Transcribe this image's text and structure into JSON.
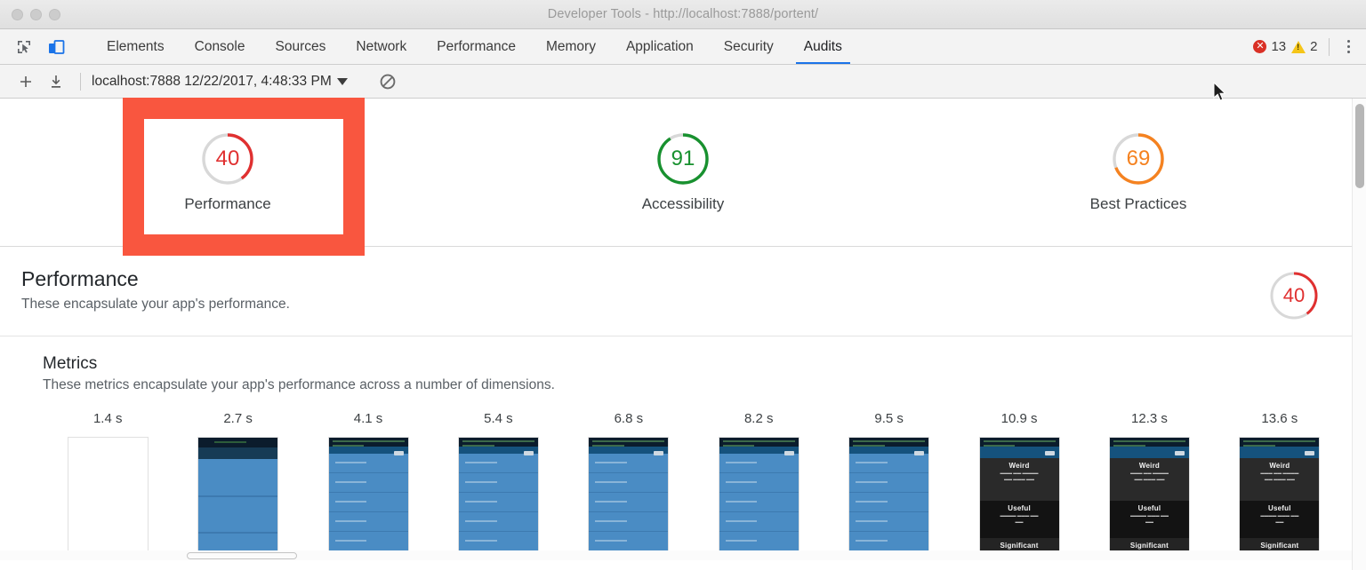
{
  "window": {
    "title": "Developer Tools - http://localhost:7888/portent/",
    "traffic_lights": [
      "close",
      "minimize",
      "zoom"
    ]
  },
  "devtools_tabbar": {
    "icons": [
      {
        "name": "inspect-element-icon",
        "glyph": "cursor-in-box"
      },
      {
        "name": "device-toolbar-icon",
        "glyph": "phone-tablet"
      }
    ],
    "tabs": [
      {
        "label": "Elements",
        "active": false
      },
      {
        "label": "Console",
        "active": false
      },
      {
        "label": "Sources",
        "active": false
      },
      {
        "label": "Network",
        "active": false
      },
      {
        "label": "Performance",
        "active": false
      },
      {
        "label": "Memory",
        "active": false
      },
      {
        "label": "Application",
        "active": false
      },
      {
        "label": "Security",
        "active": false
      },
      {
        "label": "Audits",
        "active": true
      }
    ],
    "error_count": "13",
    "warning_count": "2",
    "more_menu": "kebab-menu"
  },
  "audits_toolbar": {
    "add_label": "+",
    "import_label": "import",
    "report_selector": "localhost:7888 12/22/2017, 4:48:33 PM",
    "clear_label": "clear-all"
  },
  "scores": [
    {
      "value": "40",
      "label": "Performance",
      "color": "#e03030",
      "track": "#d8d8d8",
      "pct": 40,
      "highlighted": true
    },
    {
      "value": "91",
      "label": "Accessibility",
      "color": "#18912f",
      "track": "#d8d8d8",
      "pct": 91,
      "highlighted": false
    },
    {
      "value": "69",
      "label": "Best Practices",
      "color": "#f58220",
      "track": "#d8d8d8",
      "pct": 69,
      "highlighted": false
    }
  ],
  "section": {
    "title": "Performance",
    "subtitle": "These encapsulate your app's performance.",
    "score": {
      "value": "40",
      "color": "#e03030",
      "pct": 40
    }
  },
  "metrics": {
    "title": "Metrics",
    "subtitle": "These metrics encapsulate your app's performance across a number of dimensions.",
    "frames": [
      {
        "time": "1.4 s",
        "state": "blank"
      },
      {
        "time": "2.7 s",
        "state": "blue-skeleton"
      },
      {
        "time": "4.1 s",
        "state": "blue-list"
      },
      {
        "time": "5.4 s",
        "state": "blue-list"
      },
      {
        "time": "6.8 s",
        "state": "blue-list"
      },
      {
        "time": "8.2 s",
        "state": "blue-list"
      },
      {
        "time": "9.5 s",
        "state": "blue-list"
      },
      {
        "time": "10.9 s",
        "state": "dark-content"
      },
      {
        "time": "12.3 s",
        "state": "dark-content"
      },
      {
        "time": "13.6 s",
        "state": "dark-content"
      }
    ],
    "thumbnail_text": {
      "heading1": "Weird",
      "heading2": "Useful",
      "heading3": "Significant"
    }
  },
  "annotation": {
    "type": "red-highlight-rectangle",
    "target": "Performance score card"
  },
  "colors": {
    "accent": "#1a73e8",
    "error": "#d93025",
    "warning": "#f5c518",
    "highlight": "#f9563f"
  }
}
